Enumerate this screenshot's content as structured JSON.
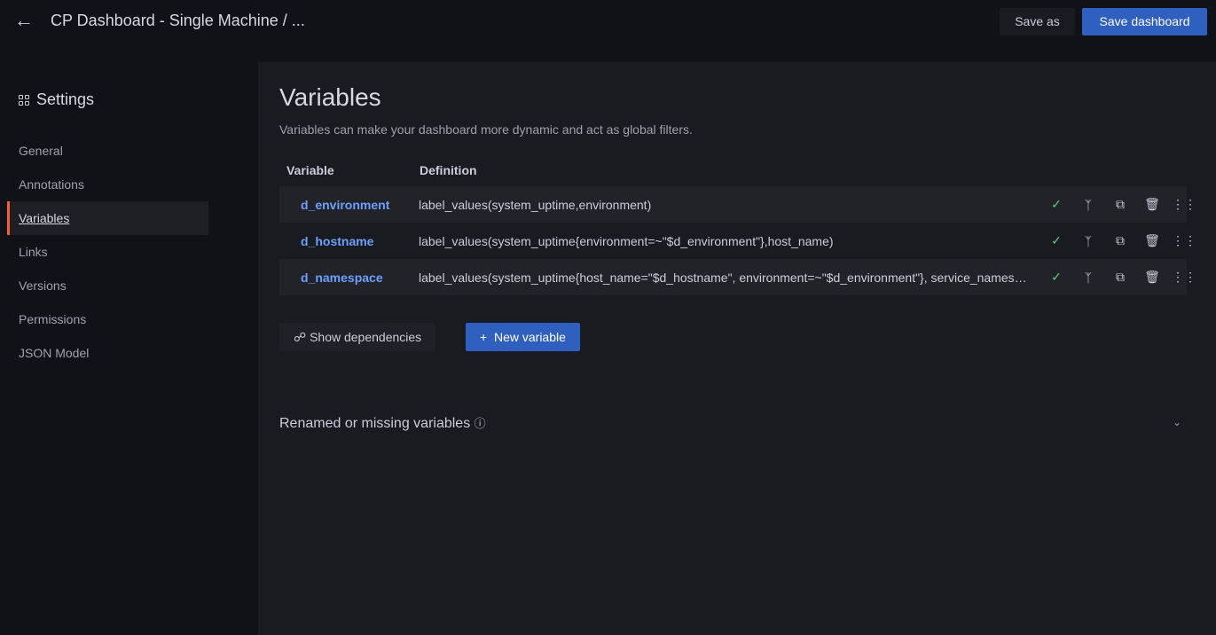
{
  "header": {
    "title": "CP Dashboard - Single Machine / ...",
    "save_as": "Save as",
    "save_dashboard": "Save dashboard"
  },
  "sidebar": {
    "title": "Settings",
    "items": [
      {
        "label": "General"
      },
      {
        "label": "Annotations"
      },
      {
        "label": "Variables"
      },
      {
        "label": "Links"
      },
      {
        "label": "Versions"
      },
      {
        "label": "Permissions"
      },
      {
        "label": "JSON Model"
      }
    ]
  },
  "main": {
    "title": "Variables",
    "subtitle": "Variables can make your dashboard more dynamic and act as global filters.",
    "columns": [
      "Variable",
      "Definition"
    ],
    "rows": [
      {
        "name": "d_environment",
        "definition": "label_values(system_uptime,environment)"
      },
      {
        "name": "d_hostname",
        "definition": "label_values(system_uptime{environment=~\"$d_environment\"},host_name)"
      },
      {
        "name": "d_namespace",
        "definition": "label_values(system_uptime{host_name=\"$d_hostname\", environment=~\"$d_environment\"}, service_namespace)"
      }
    ],
    "show_dependencies": "Show dependencies",
    "new_variable": "New variable",
    "renamed_missing": "Renamed or missing variables"
  }
}
